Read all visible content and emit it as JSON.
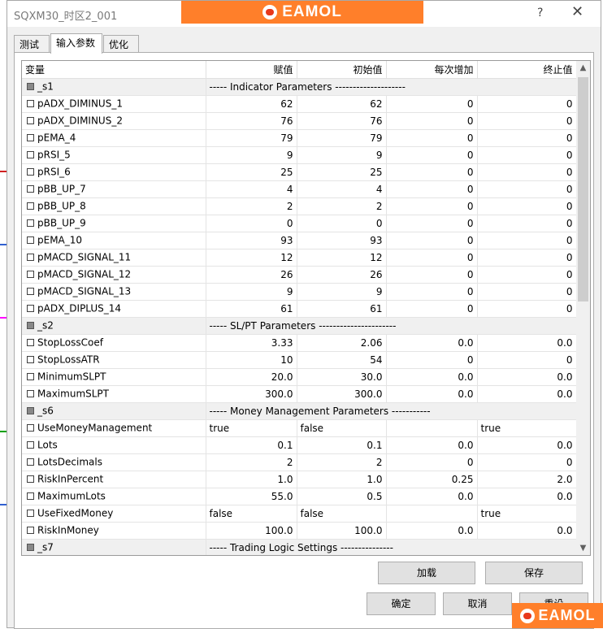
{
  "window": {
    "title": "SQXM30_时区2_001",
    "help_glyph": "?",
    "close_glyph": "✕",
    "brand_text": "EAMOL",
    "brand_icon": "eamol-logo-icon"
  },
  "tabs": [
    {
      "label": "测试",
      "active": false
    },
    {
      "label": "输入参数",
      "active": true
    },
    {
      "label": "优化",
      "active": false
    }
  ],
  "columns": [
    "变量",
    "赋值",
    "初始值",
    "每次增加",
    "终止值"
  ],
  "rows": [
    {
      "group": true,
      "name": "_s1",
      "title": "-----  Indicator Parameters  --------------------"
    },
    {
      "name": "pADX_DIMINUS_1",
      "value": "62",
      "start": "62",
      "step": "0",
      "stop": "0"
    },
    {
      "name": "pADX_DIMINUS_2",
      "value": "76",
      "start": "76",
      "step": "0",
      "stop": "0"
    },
    {
      "name": "pEMA_4",
      "value": "79",
      "start": "79",
      "step": "0",
      "stop": "0"
    },
    {
      "name": "pRSI_5",
      "value": "9",
      "start": "9",
      "step": "0",
      "stop": "0"
    },
    {
      "name": "pRSI_6",
      "value": "25",
      "start": "25",
      "step": "0",
      "stop": "0"
    },
    {
      "name": "pBB_UP_7",
      "value": "4",
      "start": "4",
      "step": "0",
      "stop": "0"
    },
    {
      "name": "pBB_UP_8",
      "value": "2",
      "start": "2",
      "step": "0",
      "stop": "0"
    },
    {
      "name": "pBB_UP_9",
      "value": "0",
      "start": "0",
      "step": "0",
      "stop": "0"
    },
    {
      "name": "pEMA_10",
      "value": "93",
      "start": "93",
      "step": "0",
      "stop": "0"
    },
    {
      "name": "pMACD_SIGNAL_11",
      "value": "12",
      "start": "12",
      "step": "0",
      "stop": "0"
    },
    {
      "name": "pMACD_SIGNAL_12",
      "value": "26",
      "start": "26",
      "step": "0",
      "stop": "0"
    },
    {
      "name": "pMACD_SIGNAL_13",
      "value": "9",
      "start": "9",
      "step": "0",
      "stop": "0"
    },
    {
      "name": "pADX_DIPLUS_14",
      "value": "61",
      "start": "61",
      "step": "0",
      "stop": "0"
    },
    {
      "group": true,
      "name": "_s2",
      "title": "-----  SL/PT Parameters  ----------------------"
    },
    {
      "name": "StopLossCoef",
      "value": "3.33",
      "start": "2.06",
      "step": "0.0",
      "stop": "0.0"
    },
    {
      "name": "StopLossATR",
      "value": "10",
      "start": "54",
      "step": "0",
      "stop": "0"
    },
    {
      "name": "MinimumSLPT",
      "value": "20.0",
      "start": "30.0",
      "step": "0.0",
      "stop": "0.0"
    },
    {
      "name": "MaximumSLPT",
      "value": "300.0",
      "start": "300.0",
      "step": "0.0",
      "stop": "0.0"
    },
    {
      "group": true,
      "name": "_s6",
      "title": "-----  Money Management Parameters  -----------"
    },
    {
      "name": "UseMoneyManagement",
      "value": "true",
      "start": "false",
      "step": "",
      "stop": "true",
      "bool": true
    },
    {
      "name": "Lots",
      "value": "0.1",
      "start": "0.1",
      "step": "0.0",
      "stop": "0.0"
    },
    {
      "name": "LotsDecimals",
      "value": "2",
      "start": "2",
      "step": "0",
      "stop": "0"
    },
    {
      "name": "RiskInPercent",
      "value": "1.0",
      "start": "1.0",
      "step": "0.25",
      "stop": "2.0"
    },
    {
      "name": "MaximumLots",
      "value": "55.0",
      "start": "0.5",
      "step": "0.0",
      "stop": "0.0"
    },
    {
      "name": "UseFixedMoney",
      "value": "false",
      "start": "false",
      "step": "",
      "stop": "true",
      "bool": true
    },
    {
      "name": "RiskInMoney",
      "value": "100.0",
      "start": "100.0",
      "step": "0.0",
      "stop": "0.0"
    },
    {
      "group": true,
      "name": "_s7",
      "title": "-----  Trading Logic Settings  ---------------"
    }
  ],
  "scroll": {
    "up_glyph": "▲",
    "down_glyph": "▼"
  },
  "buttons": {
    "load": "加载",
    "save": "保存",
    "ok": "确定",
    "cancel": "取消",
    "reset": "重设"
  },
  "watermark": {
    "text": "EAMOL"
  }
}
